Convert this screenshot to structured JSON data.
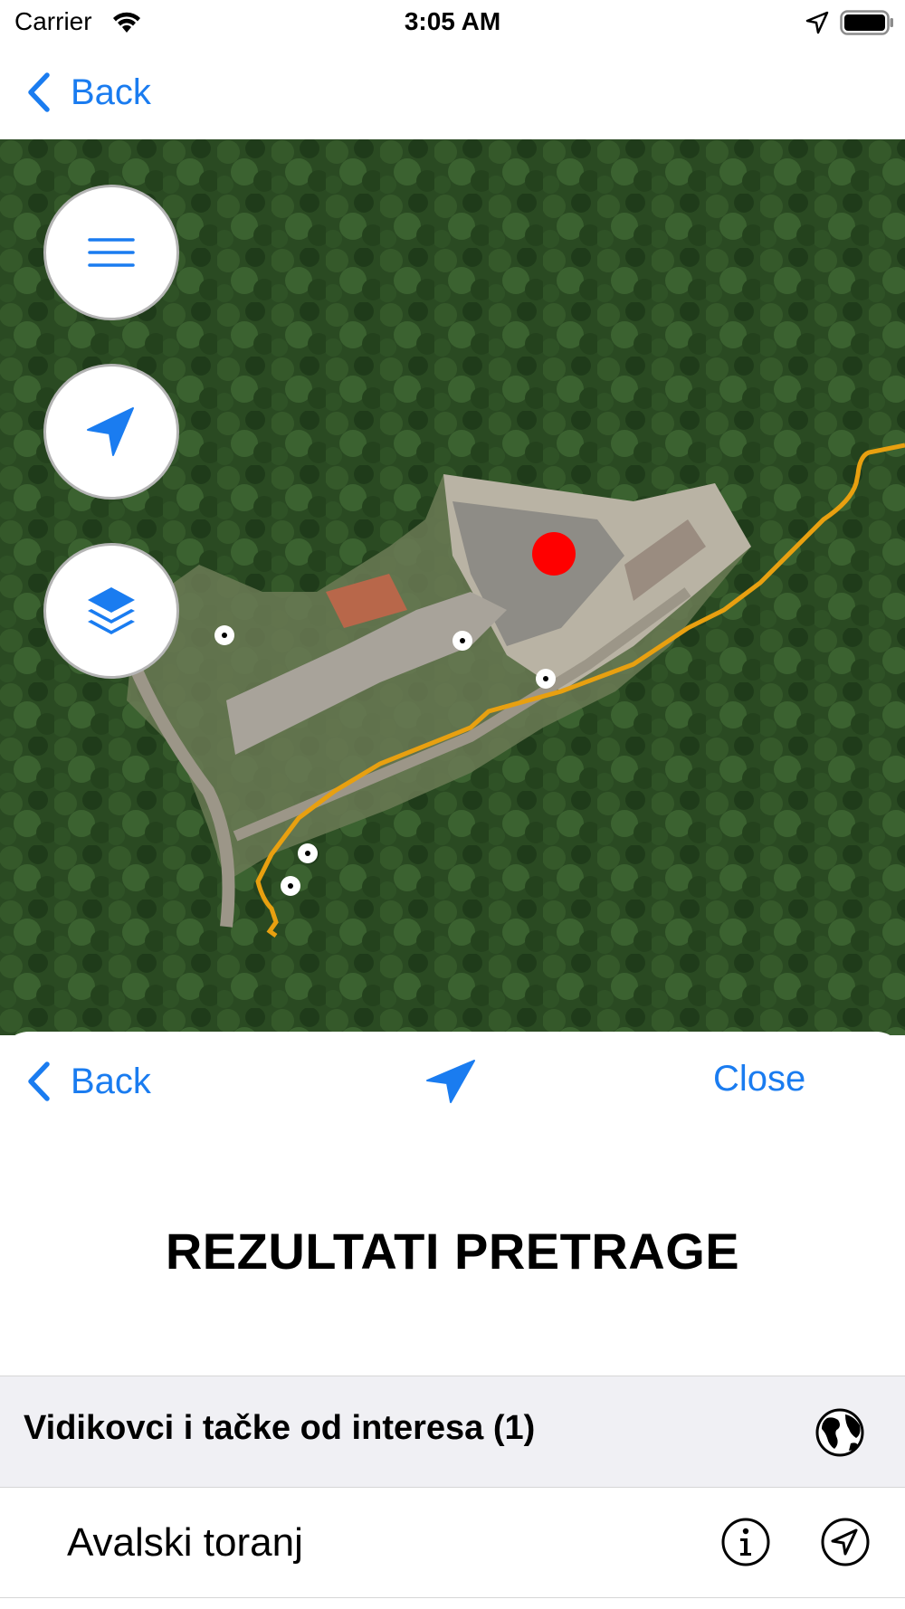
{
  "status_bar": {
    "carrier": "Carrier",
    "time": "3:05 AM",
    "icons": [
      "wifi-icon",
      "location-arrow-icon",
      "battery-icon"
    ]
  },
  "nav_bar": {
    "back_label": "Back"
  },
  "map": {
    "buttons": [
      "menu-icon",
      "location-arrow-icon",
      "layers-icon"
    ],
    "colors": {
      "route": "#e8a010",
      "selected_marker": "#ff0000",
      "poi_marker": "#ffffff"
    }
  },
  "sheet": {
    "back_label": "Back",
    "close_label": "Close",
    "title": "REZULTATI PRETRAGE",
    "section": {
      "label": "Vidikovci i tačke od interesa (1)",
      "icon": "globe-icon"
    },
    "results": [
      {
        "label": "Avalski toranj",
        "icons": [
          "info-icon",
          "navigate-icon"
        ]
      }
    ]
  },
  "accent_color": "#1a7cf0"
}
